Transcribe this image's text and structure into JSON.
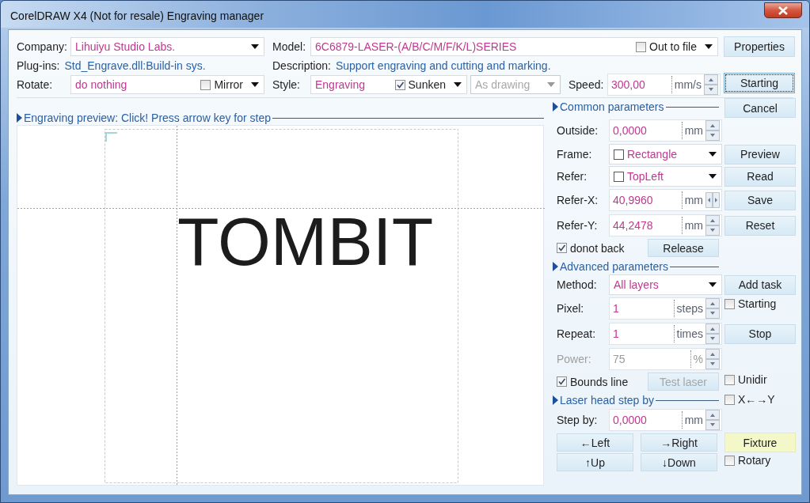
{
  "window": {
    "title": "CorelDRAW X4 (Not for resale) Engraving manager"
  },
  "header": {
    "company": {
      "label": "Company:",
      "value": "Lihuiyu Studio Labs."
    },
    "model": {
      "label": "Model:",
      "value": "6C6879-LASER-(A/B/C/M/F/K/L)SERIES"
    },
    "out_to_file": {
      "label": "Out to file",
      "checked": false
    },
    "plugins": {
      "label": "Plug-ins:",
      "value": "Std_Engrave.dll:Build-in sys."
    },
    "description": {
      "label": "Description:",
      "value": "Support engraving and cutting and marking."
    },
    "rotate": {
      "label": "Rotate:",
      "value": "do nothing"
    },
    "mirror": {
      "label": "Mirror",
      "checked": false
    },
    "style": {
      "label": "Style:",
      "value": "Engraving"
    },
    "sunken": {
      "label": "Sunken",
      "checked": true
    },
    "fill_mode": {
      "value": "As drawing",
      "disabled": true
    },
    "speed": {
      "label": "Speed:",
      "value": "300,00",
      "unit": "mm/s"
    },
    "buttons": [
      {
        "label": "Properties",
        "focused": false
      },
      {
        "label": "Starting",
        "focused": true
      }
    ]
  },
  "preview": {
    "heading": "Engraving preview: Click! Press arrow key for step",
    "text": "TOMBIT"
  },
  "panel_rows": [
    {
      "kind": "heading",
      "text": "Common parameters",
      "side": {
        "kind": "button",
        "label": "Cancel",
        "focused": false,
        "highlighted": false
      }
    },
    {
      "kind": "spin",
      "label": "Outside:",
      "value": "0,0000",
      "unit": "mm",
      "horizontal": false,
      "disabled": false
    },
    {
      "kind": "combo",
      "label": "Frame:",
      "value": "Rectangle",
      "swatch": true,
      "side": {
        "kind": "button",
        "label": "Preview",
        "focused": false,
        "highlighted": false
      }
    },
    {
      "kind": "combo",
      "label": "Refer:",
      "value": "TopLeft",
      "swatch": true,
      "side": {
        "kind": "button",
        "label": "Read",
        "focused": false,
        "highlighted": false
      }
    },
    {
      "kind": "spin",
      "label": "Refer-X:",
      "value": "40,9960",
      "unit": "mm",
      "horizontal": true,
      "disabled": false,
      "side": {
        "kind": "button",
        "label": "Save",
        "focused": false,
        "highlighted": false
      }
    },
    {
      "kind": "spin",
      "label": "Refer-Y:",
      "value": "44,2478",
      "unit": "mm",
      "horizontal": false,
      "disabled": false,
      "side": {
        "kind": "button",
        "label": "Reset",
        "focused": false,
        "highlighted": false
      }
    },
    {
      "kind": "check_button",
      "check": {
        "label": "donot back",
        "checked": true
      },
      "button": {
        "label": "Release",
        "disabled": false
      }
    },
    {
      "kind": "heading",
      "text": "Advanced parameters"
    },
    {
      "kind": "combo",
      "label": "Method:",
      "value": "All layers",
      "swatch": false,
      "side": {
        "kind": "button",
        "label": "Add task",
        "focused": false,
        "highlighted": false
      }
    },
    {
      "kind": "spin",
      "label": "Pixel:",
      "value": "1",
      "unit": "steps",
      "horizontal": false,
      "disabled": false,
      "side": {
        "kind": "checkbox",
        "label": "Starting",
        "checked": false
      }
    },
    {
      "kind": "spin",
      "label": "Repeat:",
      "value": "1",
      "unit": "times",
      "horizontal": false,
      "disabled": false,
      "side": {
        "kind": "button",
        "label": "Stop",
        "focused": false,
        "highlighted": false
      }
    },
    {
      "kind": "spin",
      "label": "Power:",
      "value": "75",
      "unit": "%",
      "horizontal": false,
      "disabled": true
    },
    {
      "kind": "check_button",
      "check": {
        "label": "Bounds line",
        "checked": true
      },
      "button": {
        "label": "Test laser",
        "disabled": true
      },
      "side": {
        "kind": "checkbox",
        "label": "Unidir",
        "checked": false
      }
    },
    {
      "kind": "heading",
      "text": "Laser head step by",
      "side": {
        "kind": "checkbox",
        "label": "X←→Y",
        "checked": false
      }
    },
    {
      "kind": "spin",
      "label": "Step by:",
      "value": "0,0000",
      "unit": "mm",
      "horizontal": false,
      "disabled": false
    },
    {
      "kind": "buttons",
      "buttons": [
        {
          "label": "←Left"
        },
        {
          "label": "→Right"
        }
      ],
      "side": {
        "kind": "button",
        "label": "Fixture",
        "focused": false,
        "highlighted": true
      }
    },
    {
      "kind": "buttons",
      "buttons": [
        {
          "label": "↑Up"
        },
        {
          "label": "↓Down"
        }
      ],
      "side": {
        "kind": "checkbox",
        "label": "Rotary",
        "checked": false
      }
    }
  ]
}
